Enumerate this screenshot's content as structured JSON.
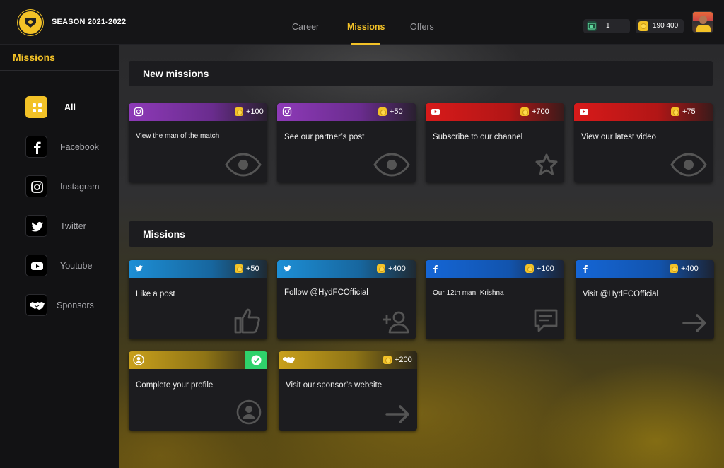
{
  "header": {
    "season": "SEASON 2021-2022",
    "tabs": [
      {
        "label": "Career"
      },
      {
        "label": "Missions"
      },
      {
        "label": "Offers"
      }
    ],
    "active_tab": "Missions",
    "tickets": "1",
    "coins": "190 400"
  },
  "sidebar": {
    "title": "Missions",
    "items": [
      {
        "label": "All",
        "icon": "grid-icon",
        "selected": true
      },
      {
        "label": "Facebook",
        "icon": "facebook-icon"
      },
      {
        "label": "Instagram",
        "icon": "instagram-icon"
      },
      {
        "label": "Twitter",
        "icon": "twitter-icon"
      },
      {
        "label": "Youtube",
        "icon": "youtube-icon"
      },
      {
        "label": "Sponsors",
        "icon": "handshake-icon"
      }
    ]
  },
  "new_missions": {
    "title": "New missions",
    "cards": [
      {
        "platform": "instagram",
        "points": "+100",
        "text": "View the man of the match",
        "action_icon": "eye-icon"
      },
      {
        "platform": "instagram",
        "points": "+50",
        "text": "See our partner’s post",
        "action_icon": "eye-icon"
      },
      {
        "platform": "youtube",
        "points": "+700",
        "text": "Subscribe to our channel",
        "action_icon": "star-icon"
      },
      {
        "platform": "youtube",
        "points": "+75",
        "text": "View our latest video",
        "action_icon": "eye-icon"
      }
    ]
  },
  "missions": {
    "title": "Missions",
    "cards": [
      {
        "platform": "twitter",
        "points": "+50",
        "text": "Like a post",
        "action_icon": "thumbs-up-icon"
      },
      {
        "platform": "twitter",
        "points": "+400",
        "text": "Follow @HydFCOfficial",
        "action_icon": "add-user-icon"
      },
      {
        "platform": "facebook",
        "points": "+100",
        "text": "Our 12th man: Krishna",
        "action_icon": "comment-icon"
      },
      {
        "platform": "facebook",
        "points": "+400",
        "text": "Visit @HydFCOfficial",
        "action_icon": "arrow-right-icon"
      },
      {
        "platform": "profile",
        "points": "",
        "text": "Complete your profile",
        "action_icon": "user-circle-icon",
        "completed": true
      },
      {
        "platform": "sponsor",
        "points": "+200",
        "text": "Visit our sponsor’s website",
        "action_icon": "arrow-right-icon"
      }
    ]
  },
  "colors": {
    "accent": "#f3c227",
    "instagram": "#8e3ab8",
    "youtube": "#d01818",
    "twitter": "#1d8fd6",
    "facebook": "#1566d6",
    "sponsor": "#c9a01c",
    "complete": "#2fd26b"
  }
}
